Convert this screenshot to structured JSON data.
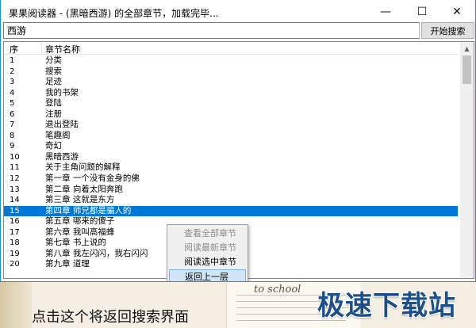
{
  "window": {
    "title": "果果阅读器 - (黑暗西游) 的全部章节，加载完毕...",
    "minimize_glyph": "—",
    "maximize_glyph": "☐",
    "close_glyph": "✕"
  },
  "search": {
    "value": "西游",
    "button_label": "开始搜索"
  },
  "list": {
    "columns": [
      "序",
      "章节名称"
    ],
    "rows": [
      {
        "num": "1",
        "name": "分类"
      },
      {
        "num": "2",
        "name": "搜索"
      },
      {
        "num": "3",
        "name": "足迹"
      },
      {
        "num": "4",
        "name": "我的书架"
      },
      {
        "num": "5",
        "name": "登陆"
      },
      {
        "num": "6",
        "name": "注册"
      },
      {
        "num": "7",
        "name": "退出登陆"
      },
      {
        "num": "8",
        "name": "笔趣阁"
      },
      {
        "num": "9",
        "name": "奇幻"
      },
      {
        "num": "10",
        "name": "黑暗西游"
      },
      {
        "num": "11",
        "name": "关于主角问题的解释"
      },
      {
        "num": "12",
        "name": "第一章 一个没有金身的佛"
      },
      {
        "num": "13",
        "name": "第二章 向着太阳奔跑"
      },
      {
        "num": "14",
        "name": "第三章 这就是东方"
      },
      {
        "num": "15",
        "name": "第四章 师兄都是骗人的"
      },
      {
        "num": "16",
        "name": "第五章 哪来的傻子"
      },
      {
        "num": "17",
        "name": "第六章 我叫高福蜂"
      },
      {
        "num": "18",
        "name": "第七章 书上说的"
      },
      {
        "num": "19",
        "name": "第八章 我左闪闪，我右闪闪"
      },
      {
        "num": "20",
        "name": "第九章 道理"
      }
    ],
    "selected_index": 14
  },
  "context_menu": {
    "items": [
      {
        "label": "查看全部章节",
        "enabled": false,
        "highlighted": false
      },
      {
        "label": "阅读最新章节",
        "enabled": false,
        "highlighted": false
      },
      {
        "label": "阅读选中章节",
        "enabled": true,
        "highlighted": false
      },
      {
        "label": "返回上一层",
        "enabled": true,
        "highlighted": true
      }
    ]
  },
  "annotation": "点击这个将返回搜索界面",
  "decoration_text": "to school",
  "watermark": "极速下载站",
  "colors": {
    "selection": "#0078d7",
    "window_border": "#1e8ed8",
    "watermark": "#1a4f8c"
  }
}
